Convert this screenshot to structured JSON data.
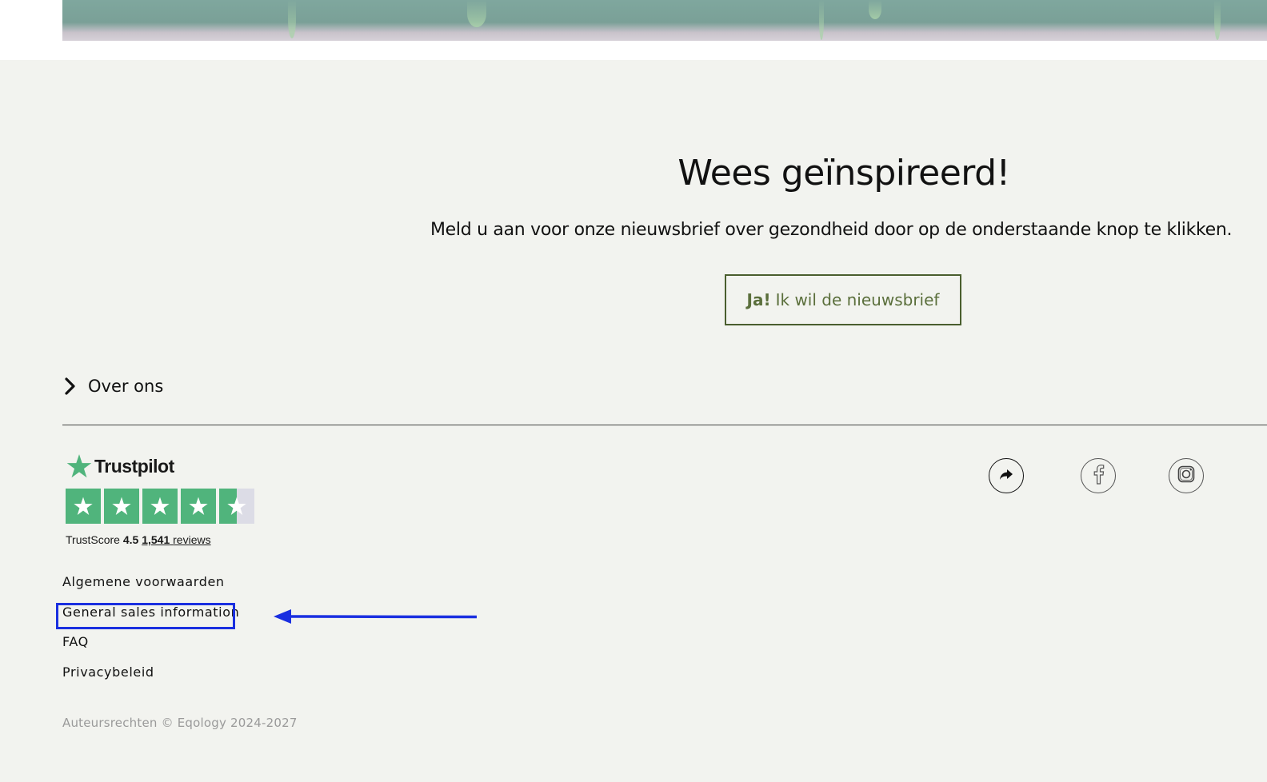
{
  "newsletter": {
    "title": "Wees geïnspireerd!",
    "text": "Meld u aan voor onze nieuwsbrief over gezondheid door op de onderstaande knop te klikken.",
    "button_strong": "Ja!",
    "button_label": "Ik wil de nieuwsbrief"
  },
  "about": {
    "label": "Over ons",
    "icon": "chevron-right-icon"
  },
  "trustpilot": {
    "brand": "Trustpilot",
    "score_label": "TrustScore",
    "score": "4.5",
    "reviews_count": "1,541",
    "reviews_label": "reviews",
    "rating_value": 4.5,
    "rating_max": 5,
    "star_color": "#50b47c"
  },
  "social": {
    "items": [
      {
        "icon": "share-icon"
      },
      {
        "icon": "facebook-icon"
      },
      {
        "icon": "instagram-icon"
      }
    ]
  },
  "links": {
    "items": [
      {
        "label": "Algemene voorwaarden"
      },
      {
        "label": "General sales information"
      },
      {
        "label": "FAQ"
      },
      {
        "label": "Privacybeleid"
      }
    ]
  },
  "copyright": "Auteursrechten © Eqology 2024-2027",
  "colors": {
    "footer_bg": "#f2f3ef",
    "button_border": "#4a5e2e",
    "button_text": "#5b6f3c",
    "highlight": "#1a2fe0"
  }
}
